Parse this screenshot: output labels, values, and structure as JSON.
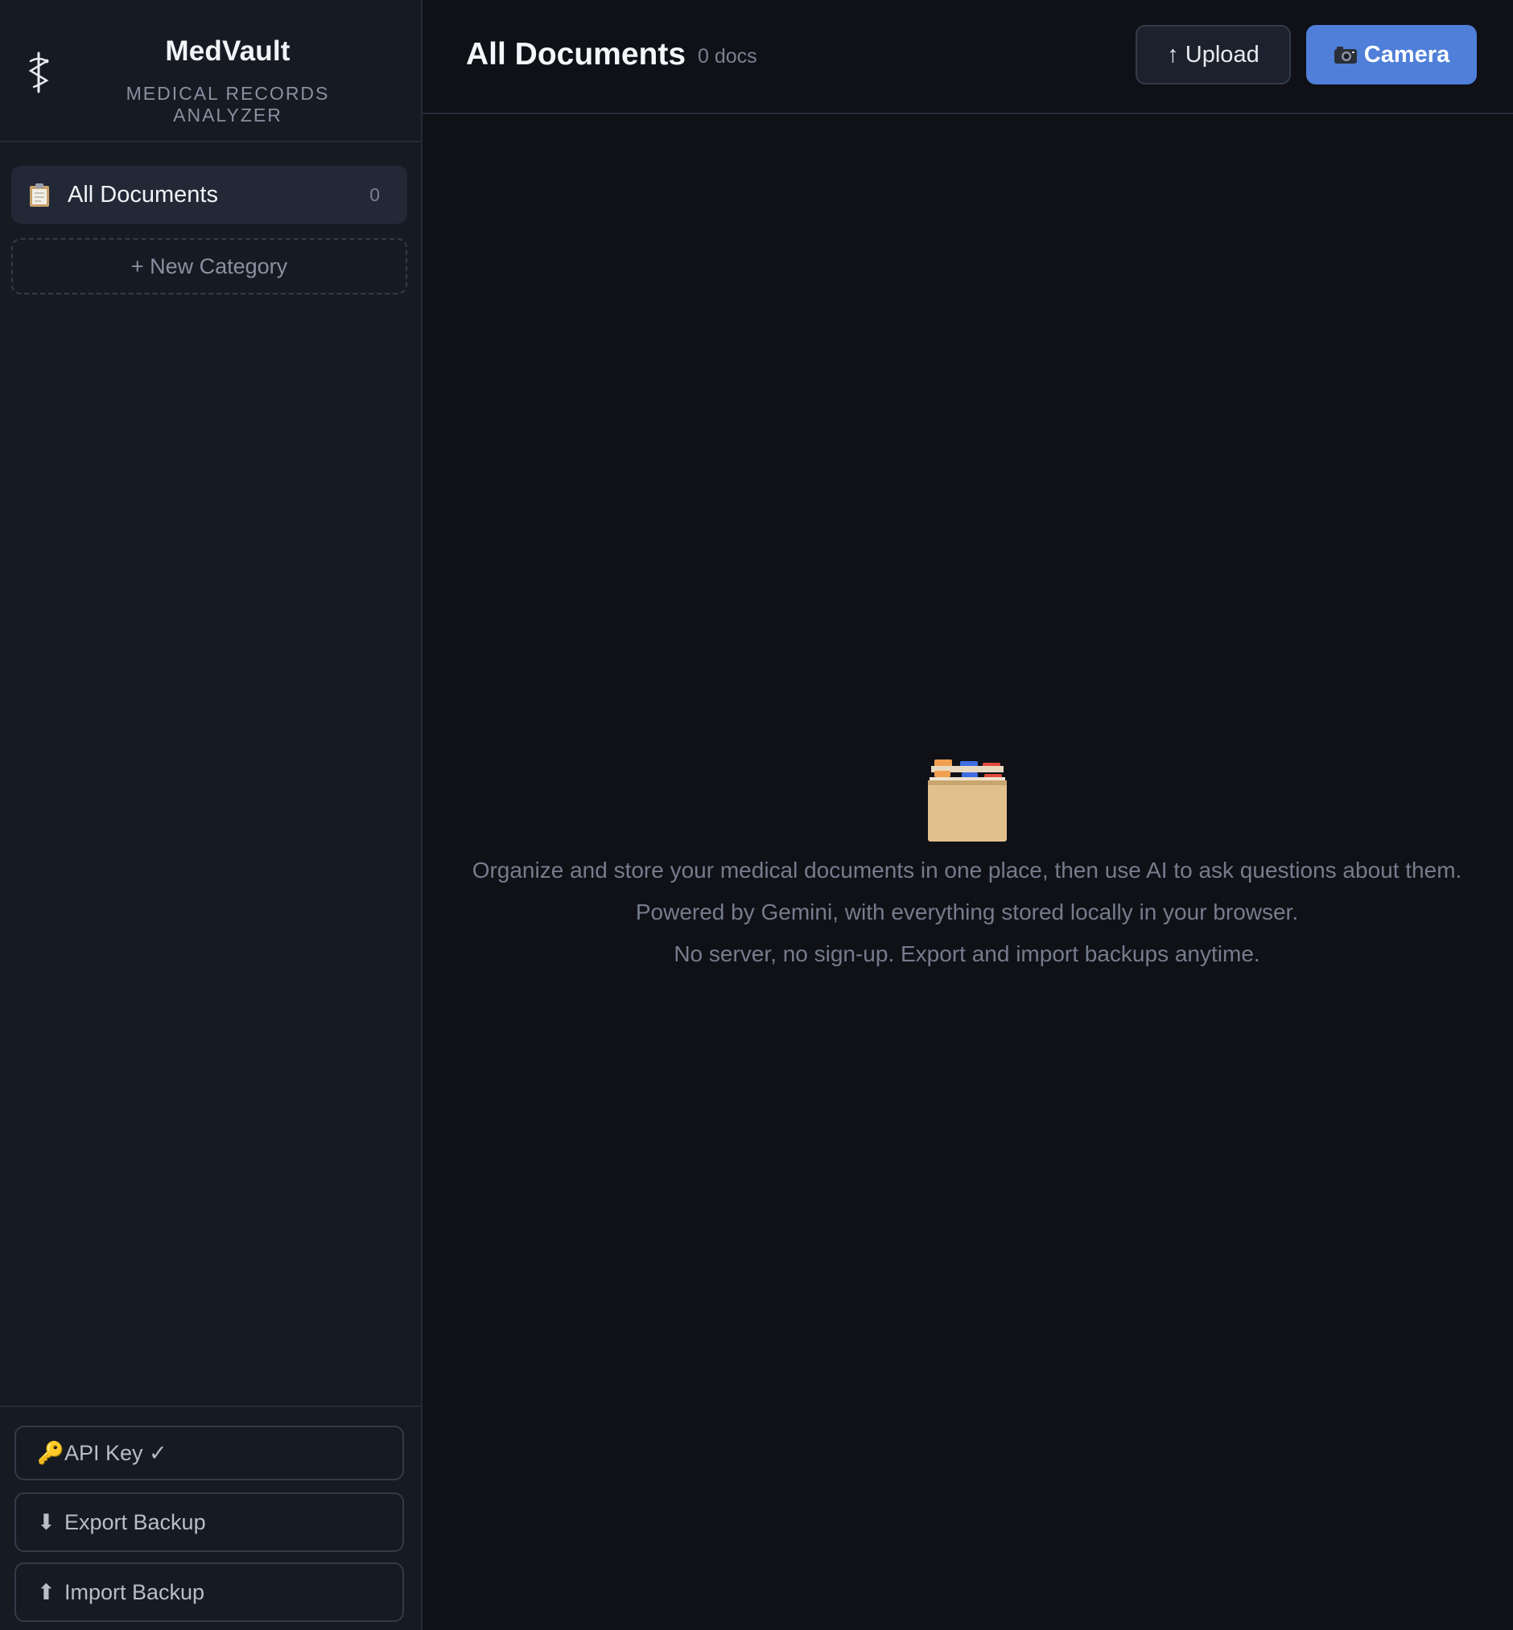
{
  "brand": {
    "title": "MedVault",
    "subtitle": "MEDICAL RECORDS ANALYZER",
    "icon": "caduceus-icon"
  },
  "sidebar": {
    "items": [
      {
        "icon": "clipboard-icon",
        "label": "All Documents",
        "count": "0"
      }
    ],
    "new_category_label": "+ New Category",
    "footer": {
      "api_key_label": "API Key ✓",
      "export_label": "Export Backup",
      "import_label": "Import Backup"
    }
  },
  "header": {
    "title": "All Documents",
    "doc_count": "0 docs",
    "upload_label": "Upload",
    "camera_label": "Camera"
  },
  "empty_state": {
    "icon": "card-file-box-icon",
    "lines": [
      "Organize and store your medical documents in one place, then use AI to ask questions about them.",
      "Powered by Gemini, with everything stored locally in your browser.",
      "No server, no sign-up. Export and import backups anytime."
    ]
  },
  "colors": {
    "background": "#0f1117",
    "sidebar": "#161a23",
    "accent": "#4f7fd8",
    "active_item": "#222836"
  }
}
